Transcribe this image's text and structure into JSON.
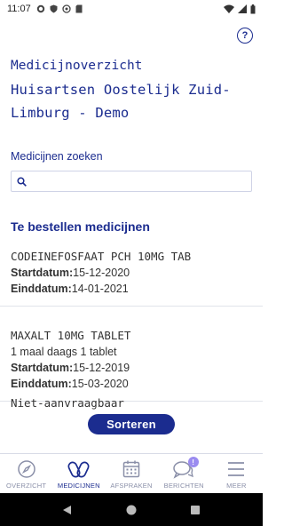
{
  "status": {
    "time": "11:07"
  },
  "header": {
    "title_line1": "Medicijnoverzicht",
    "title_line2": "Huisartsen Oostelijk Zuid-",
    "title_line3": "Limburg - Demo"
  },
  "search": {
    "label": "Medicijnen zoeken",
    "value": "",
    "placeholder": ""
  },
  "section": {
    "title": "Te bestellen medicijnen"
  },
  "medicines": [
    {
      "name": "CODEINEFOSFAAT PCH 10MG TAB",
      "dosage": "",
      "start_label": "Startdatum:",
      "start": "15-12-2020",
      "end_label": "Einddatum:",
      "end": "14-01-2021"
    },
    {
      "name": "MAXALT 10MG TABLET",
      "dosage": "1 maal daags 1 tablet",
      "start_label": "Startdatum:",
      "start": "15-12-2019",
      "end_label": "Einddatum:",
      "end": "15-03-2020"
    }
  ],
  "unavailable_label": "Niet-aanvraagbaar",
  "sort_button": "Sorteren",
  "nav": {
    "items": [
      {
        "label": "OVERZICHT",
        "icon": "compass-icon"
      },
      {
        "label": "MEDICIJNEN",
        "icon": "pills-icon"
      },
      {
        "label": "AFSPRAKEN",
        "icon": "calendar-icon"
      },
      {
        "label": "BERICHTEN",
        "icon": "chat-icon",
        "badge": "!"
      },
      {
        "label": "MEER",
        "icon": "menu-icon"
      }
    ]
  },
  "colors": {
    "brand": "#1b2c8f",
    "badge": "#9b8cf0"
  }
}
